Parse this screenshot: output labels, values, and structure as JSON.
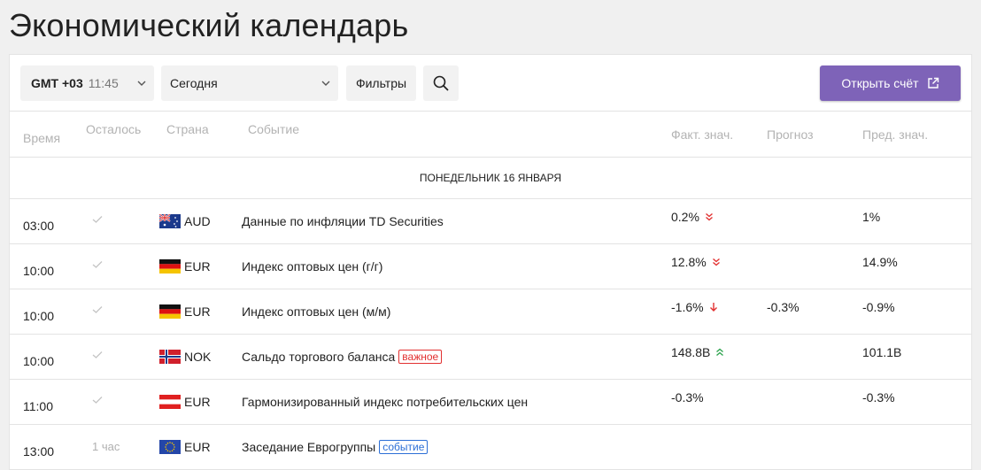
{
  "page": {
    "title": "Экономический календарь"
  },
  "toolbar": {
    "timezone": {
      "label": "GMT +03",
      "time": "11:45"
    },
    "date_select": "Сегодня",
    "filters_label": "Фильтры",
    "open_account_label": "Открыть счёт"
  },
  "columns": {
    "time": "Время",
    "remaining": "Осталось",
    "country": "Страна",
    "event": "Событие",
    "actual": "Факт. знач.",
    "forecast": "Прогноз",
    "previous": "Пред. знач."
  },
  "day_header": "ПОНЕДЕЛЬНИК 16 ЯНВАРЯ",
  "colors": {
    "accent": "#7e63b8",
    "down": "#e23030",
    "up": "#2ea44f",
    "event_badge": "#2c6fd6"
  },
  "rows": [
    {
      "time": "03:00",
      "remaining": "",
      "remaining_icon": "check-icon",
      "flag": "australia",
      "currency": "AUD",
      "event": "Данные по инфляции TD Securities",
      "badge": "",
      "actual": "0.2%",
      "trend": "double-down",
      "forecast": "",
      "previous": "1%"
    },
    {
      "time": "10:00",
      "remaining": "",
      "remaining_icon": "check-icon",
      "flag": "germany",
      "currency": "EUR",
      "event": "Индекс оптовых цен (г/г)",
      "badge": "",
      "actual": "12.8%",
      "trend": "double-down",
      "forecast": "",
      "previous": "14.9%"
    },
    {
      "time": "10:00",
      "remaining": "",
      "remaining_icon": "check-icon",
      "flag": "germany",
      "currency": "EUR",
      "event": "Индекс оптовых цен (м/м)",
      "badge": "",
      "actual": "-1.6%",
      "trend": "down",
      "forecast": "-0.3%",
      "previous": "-0.9%"
    },
    {
      "time": "10:00",
      "remaining": "",
      "remaining_icon": "check-icon",
      "flag": "norway",
      "currency": "NOK",
      "event": "Сальдо торгового баланса",
      "badge": "важное",
      "actual": "148.8B",
      "trend": "double-up",
      "forecast": "",
      "previous": "101.1B"
    },
    {
      "time": "11:00",
      "remaining": "",
      "remaining_icon": "check-icon",
      "flag": "austria",
      "currency": "EUR",
      "event": "Гармонизированный индекс потребительских цен",
      "badge": "",
      "actual": "-0.3%",
      "trend": "",
      "forecast": "",
      "previous": "-0.3%"
    },
    {
      "time": "13:00",
      "remaining": "1 час",
      "remaining_icon": "",
      "flag": "eu",
      "currency": "EUR",
      "event": "Заседание Еврогруппы",
      "badge": "событие",
      "actual": "",
      "trend": "",
      "forecast": "",
      "previous": ""
    }
  ]
}
